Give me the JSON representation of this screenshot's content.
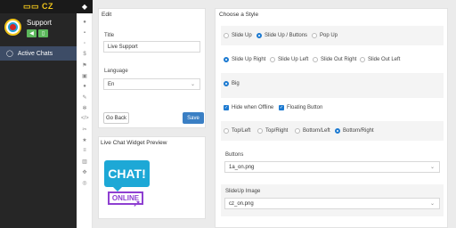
{
  "app": {
    "logo": "CZ",
    "rail_top_icon": "cat-icon"
  },
  "agent": {
    "name": "Support",
    "sound_btn": "sound-icon",
    "mobile_btn": "mobile-icon"
  },
  "nav": {
    "active_chats": "Active Chats"
  },
  "edit_panel": {
    "title": "Edit",
    "title_label": "Title",
    "title_value": "Live Support",
    "language_label": "Language",
    "language_value": "En",
    "back_label": "Go Back",
    "save_label": "Save"
  },
  "preview": {
    "title": "Live Chat Widget Preview",
    "chat_text": "CHAT!",
    "online_text": "ONLINE"
  },
  "style_panel": {
    "title": "Choose a Style",
    "styles": [
      "Slide Up",
      "Slide Up / Buttons",
      "Pop Up"
    ],
    "directions": [
      "Slide Up Right",
      "Slide Up Left",
      "Slide Out Right",
      "Slide Out Left"
    ],
    "size": "Big",
    "hide_offline": "Hide when Offline",
    "floating_button": "Floating Button",
    "positions": [
      "Top/Left",
      "Top/Right",
      "Bottom/Left",
      "Bottom/Right"
    ],
    "buttons_label": "Buttons",
    "buttons_value": "1a_on.png",
    "slideup_label": "SlideUp Image",
    "slideup_value": "cz_on.png"
  },
  "colors": {
    "accent": "#1c7ad1",
    "save": "#3a7fc4",
    "sidebar": "#262626",
    "active": "#3d4c66",
    "logo": "#f0c51a"
  }
}
